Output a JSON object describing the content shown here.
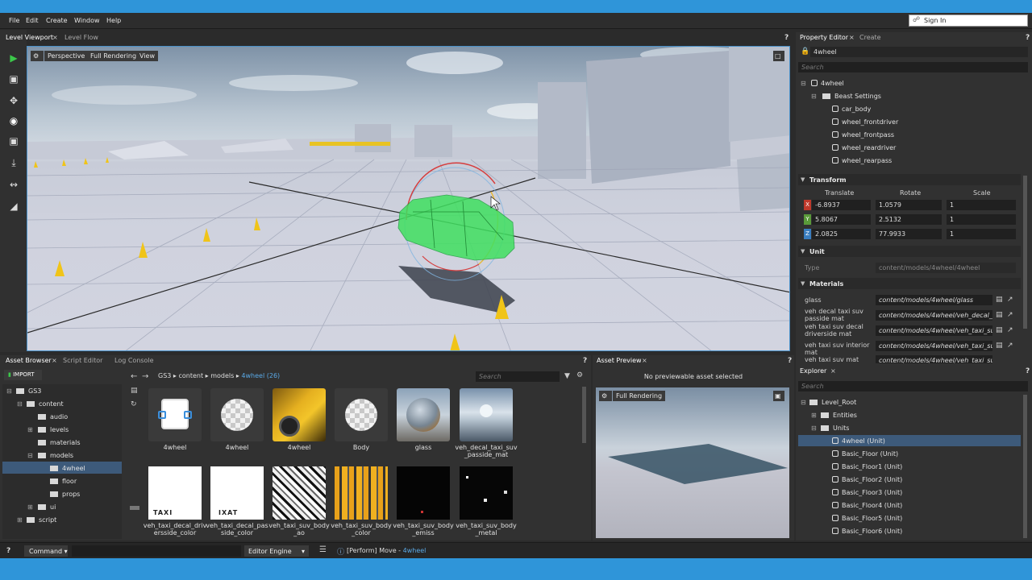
{
  "colors": {
    "accent_blue": "#2f95d9",
    "selection": "#3d5a7a",
    "highlight_text": "#5aa9e6"
  },
  "menu": [
    "File",
    "Edit",
    "Create",
    "Window",
    "Help"
  ],
  "signin": {
    "label": "Sign In",
    "icon": "signin-icon"
  },
  "viewport": {
    "tabs": [
      "Level Viewport",
      "Level Flow"
    ],
    "help": "?",
    "buttons": {
      "perspective": "Perspective",
      "rendering": "Full Rendering",
      "view": "View"
    }
  },
  "property_editor": {
    "tabs": [
      "Property Editor",
      "Create"
    ],
    "help": "?",
    "object_name": "4wheel",
    "search_placeholder": "Search",
    "tree": {
      "root": "4wheel",
      "group": "Beast Settings",
      "items": [
        "car_body",
        "wheel_frontdriver",
        "wheel_frontpass",
        "wheel_reardriver",
        "wheel_rearpass"
      ]
    },
    "transform": {
      "title": "Transform",
      "columns": [
        "Translate",
        "Rotate",
        "Scale"
      ],
      "rows": [
        {
          "axis": "X",
          "color": "#c0392b",
          "translate": "-6.8937",
          "rotate": "1.0579",
          "scale": "1"
        },
        {
          "axis": "Y",
          "color": "#5a9a3a",
          "translate": "5.8067",
          "rotate": "2.5132",
          "scale": "1"
        },
        {
          "axis": "Z",
          "color": "#3a7ec0",
          "translate": "2.0825",
          "rotate": "77.9933",
          "scale": "1"
        }
      ]
    },
    "unit": {
      "title": "Unit",
      "type_label": "Type",
      "type_value": "content/models/4wheel/4wheel"
    },
    "materials": {
      "title": "Materials",
      "rows": [
        {
          "name": "glass",
          "value": "content/models/4wheel/glass"
        },
        {
          "name": "veh decal taxi suv passide mat",
          "value": "content/models/4wheel/veh_decal_taxi"
        },
        {
          "name": "veh taxi suv decal driverside mat",
          "value": "content/models/4wheel/veh_taxi_suv_d"
        },
        {
          "name": "veh taxi suv interior mat",
          "value": "content/models/4wheel/veh_taxi_suv_i"
        },
        {
          "name": "veh taxi suv mat",
          "value": "content/models/4wheel/veh_taxi_suv_i"
        }
      ]
    }
  },
  "asset_browser": {
    "tabs": [
      "Asset Browser",
      "Script Editor",
      "Log Console"
    ],
    "help": "?",
    "import_label": "IMPORT",
    "breadcrumb": [
      "GS3",
      "content",
      "models"
    ],
    "current_folder": "4wheel (26)",
    "search_placeholder": "Search",
    "tree": [
      {
        "label": "GS3",
        "level": 0
      },
      {
        "label": "content",
        "level": 1
      },
      {
        "label": "audio",
        "level": 2
      },
      {
        "label": "levels",
        "level": 2
      },
      {
        "label": "materials",
        "level": 2
      },
      {
        "label": "models",
        "level": 2
      },
      {
        "label": "4wheel",
        "level": 3
      },
      {
        "label": "floor",
        "level": 3
      },
      {
        "label": "props",
        "level": 3
      },
      {
        "label": "ui",
        "level": 2
      },
      {
        "label": "script",
        "level": 1
      }
    ],
    "assets_row1": [
      "4wheel",
      "4wheel",
      "4wheel",
      "Body",
      "glass",
      "veh_decal_taxi_suv\n_passide_mat"
    ],
    "assets_row2": [
      "veh_taxi_decal_driv\nersside_color",
      "veh_taxi_decal_pas\nside_color",
      "veh_taxi_suv_body\n_ao",
      "veh_taxi_suv_body\n_color",
      "veh_taxi_suv_body\n_emiss",
      "veh_taxi_suv_body\n_metal"
    ],
    "thumb_text": {
      "taxi1": "TAXI",
      "taxi2": "IXAT"
    }
  },
  "asset_preview": {
    "tabs": [
      "Asset Preview"
    ],
    "help": "?",
    "message": "No previewable asset selected",
    "rendering": "Full Rendering"
  },
  "explorer": {
    "tabs": [
      "Explorer"
    ],
    "help": "?",
    "search_placeholder": "Search",
    "root": "Level_Root",
    "groups": [
      "Entities",
      "Units"
    ],
    "items": [
      "4wheel (Unit)",
      "Basic_Floor (Unit)",
      "Basic_Floor1 (Unit)",
      "Basic_Floor2 (Unit)",
      "Basic_Floor3 (Unit)",
      "Basic_Floor4 (Unit)",
      "Basic_Floor5 (Unit)",
      "Basic_Floor6 (Unit)"
    ]
  },
  "statusbar": {
    "help": "?",
    "command_label": "Command",
    "engine_label": "Editor Engine",
    "log_prefix": "[Perform] Move - ",
    "log_target": "4wheel"
  }
}
